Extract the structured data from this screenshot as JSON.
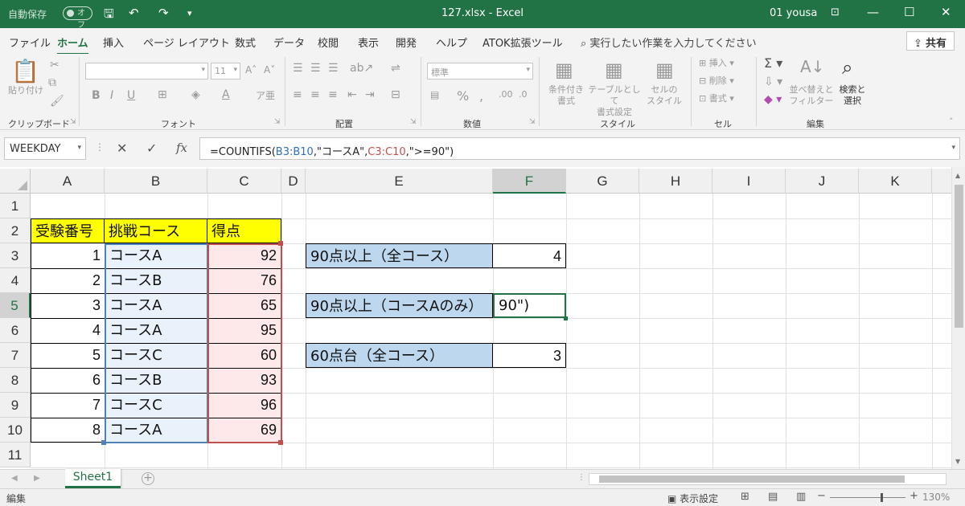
{
  "titlebar": {
    "autosave_label": "自動保存",
    "autosave_state": "オフ",
    "file_title": "127.xlsx  -  Excel",
    "user": "01 yousa"
  },
  "tabs": [
    "ファイル",
    "ホーム",
    "挿入",
    "ページ レイアウト",
    "数式",
    "データ",
    "校閲",
    "表示",
    "開発",
    "ヘルプ",
    "ATOK拡張ツール"
  ],
  "active_tab": "ホーム",
  "tell_me": "実行したい作業を入力してください",
  "share_label": "共有",
  "ribbon": {
    "groups": [
      "クリップボード",
      "フォント",
      "配置",
      "数値",
      "スタイル",
      "セル",
      "編集"
    ],
    "paste_label": "貼り付け",
    "font_size": "11",
    "number_format": "標準",
    "bold": "B",
    "italic": "I",
    "underline": "U",
    "cond_format": [
      "条件付き",
      "書式"
    ],
    "table_format": [
      "テーブルとして",
      "書式設定"
    ],
    "cell_style": [
      "セルの",
      "スタイル"
    ],
    "insert": "挿入",
    "delete": "削除",
    "format": "書式",
    "sort_filter": [
      "並べ替えと",
      "フィルター"
    ],
    "find_select": [
      "検索と",
      "選択"
    ]
  },
  "formula_bar": {
    "name_box": "WEEKDAY",
    "cancel": "✕",
    "enter": "✓",
    "fx": "fx",
    "formula_prefix": "=COUNTIFS(",
    "ref1": "B3:B10",
    "mid": ",\"コースA\",",
    "ref2": "C3:C10",
    "formula_suffix": ",\">=90\")"
  },
  "columns": [
    "A",
    "B",
    "C",
    "D",
    "E",
    "F",
    "G",
    "H",
    "I",
    "J",
    "K"
  ],
  "selected_column": "F",
  "rows": [
    "1",
    "2",
    "3",
    "4",
    "5",
    "6",
    "7",
    "8",
    "9",
    "10",
    "11"
  ],
  "selected_row": "5",
  "table": {
    "headers": [
      "受験番号",
      "挑戦コース",
      "得点"
    ],
    "data": [
      [
        "1",
        "コースA",
        "92"
      ],
      [
        "2",
        "コースB",
        "76"
      ],
      [
        "3",
        "コースA",
        "65"
      ],
      [
        "4",
        "コースA",
        "95"
      ],
      [
        "5",
        "コースC",
        "60"
      ],
      [
        "6",
        "コースB",
        "93"
      ],
      [
        "7",
        "コースC",
        "96"
      ],
      [
        "8",
        "コースA",
        "69"
      ]
    ]
  },
  "summary": [
    {
      "label": "90点以上（全コース）",
      "value": "4"
    },
    {
      "label": "90点以上（コースAのみ）",
      "value": "90\")"
    },
    {
      "label": "60点台（全コース）",
      "value": "3"
    }
  ],
  "sheet_tab": "Sheet1",
  "status": {
    "mode": "編集",
    "display_settings": "表示設定",
    "zoom": "130%"
  }
}
